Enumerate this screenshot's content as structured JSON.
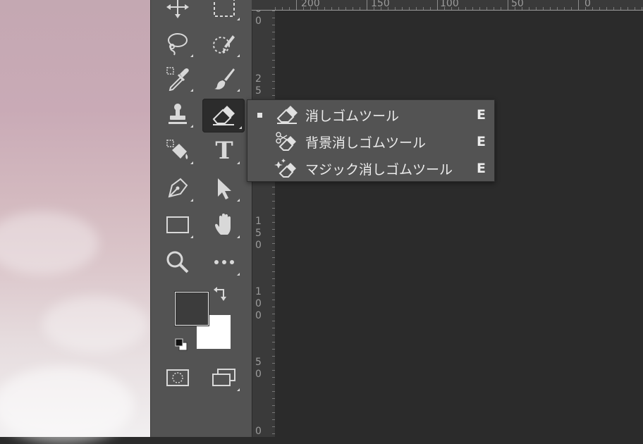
{
  "toolbar": {
    "tools": [
      {
        "name": "move-icon"
      },
      {
        "name": "rectangular-marquee-icon"
      },
      {
        "name": "lasso-icon"
      },
      {
        "name": "quick-selection-icon"
      },
      {
        "name": "eyedropper-icon"
      },
      {
        "name": "brush-icon"
      },
      {
        "name": "clone-stamp-icon"
      },
      {
        "name": "eraser-icon",
        "active": true
      },
      {
        "name": "paint-bucket-icon"
      },
      {
        "name": "type-icon"
      },
      {
        "name": "pen-icon"
      },
      {
        "name": "path-selection-icon"
      },
      {
        "name": "rectangle-shape-icon"
      },
      {
        "name": "hand-icon"
      },
      {
        "name": "zoom-icon"
      },
      {
        "name": "more-tools-icon"
      },
      {
        "name": "swap-colors-icon"
      },
      {
        "name": "default-colors-icon"
      },
      {
        "name": "quick-mask-icon"
      },
      {
        "name": "screen-mode-icon"
      }
    ],
    "type_tool_glyph": "T",
    "foreground_color": "#3c3c3c",
    "background_color": "#ffffff"
  },
  "ruler": {
    "horizontal_labels": [
      "200",
      "150",
      "100",
      "50",
      "0"
    ],
    "vertical_labels": [
      "0\n0",
      "2\n5",
      "1\n5\n0",
      "1\n0\n0",
      "5\n0",
      "0"
    ]
  },
  "flyout": {
    "items": [
      {
        "label": "消しゴムツール",
        "shortcut": "E",
        "selected": true,
        "icon": "eraser-icon"
      },
      {
        "label": "背景消しゴムツール",
        "shortcut": "E",
        "selected": false,
        "icon": "background-eraser-icon"
      },
      {
        "label": "マジック消しゴムツール",
        "shortcut": "E",
        "selected": false,
        "icon": "magic-eraser-icon"
      }
    ]
  },
  "colors": {
    "toolbar_bg": "#535353",
    "canvas_bg": "#2b2b2b",
    "ruler_bg": "#3a3a3a",
    "icon": "#d8d8d8"
  }
}
